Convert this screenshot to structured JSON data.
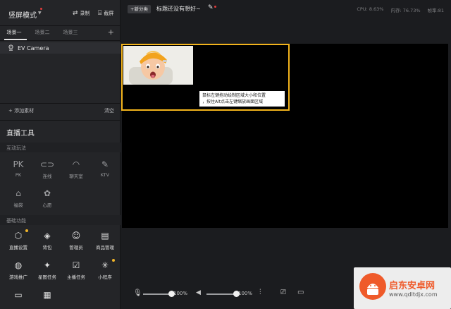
{
  "left_panel": {
    "mode_title": "竖屏模式",
    "record_label": "录制",
    "screenshot_label": "截屏",
    "scene_tabs": [
      "场景一",
      "场景二",
      "场景三"
    ],
    "sources": [
      {
        "label": "EV Camera"
      }
    ],
    "add_material": "+ 添加素材",
    "clear": "清空",
    "tools_title": "直播工具",
    "sections": {
      "interactive": "互动玩法",
      "basic": "基础功能"
    },
    "interactive_tools": [
      {
        "label": "PK",
        "icon": "pk-icon",
        "glyph": "PK"
      },
      {
        "label": "连线",
        "icon": "link-icon",
        "glyph": "⊂⊃"
      },
      {
        "label": "聊天室",
        "icon": "chat-room-icon",
        "glyph": "◠"
      },
      {
        "label": "KTV",
        "icon": "microphone-icon",
        "glyph": "✎"
      },
      {
        "label": "福袋",
        "icon": "lucky-bag-icon",
        "glyph": "⌂"
      },
      {
        "label": "心愿",
        "icon": "wish-icon",
        "glyph": "✿"
      }
    ],
    "basic_tools": [
      {
        "label": "直播设置",
        "icon": "settings-hex-icon",
        "glyph": "⬡"
      },
      {
        "label": "背包",
        "icon": "backpack-icon",
        "glyph": "◈"
      },
      {
        "label": "管理员",
        "icon": "admin-icon",
        "glyph": "☺"
      },
      {
        "label": "商品管理",
        "icon": "shop-icon",
        "glyph": "▤"
      },
      {
        "label": "游戏推广",
        "icon": "gamepad-icon",
        "glyph": "◍"
      },
      {
        "label": "星图任务",
        "icon": "star-map-icon",
        "glyph": "✦"
      },
      {
        "label": "主播任务",
        "icon": "task-check-icon",
        "glyph": "☑"
      },
      {
        "label": "小程序",
        "icon": "mini-program-icon",
        "glyph": "✳"
      },
      {
        "label": "",
        "icon": "screen-share-icon",
        "glyph": "▭"
      },
      {
        "label": "",
        "icon": "layout-icon",
        "glyph": "▦"
      }
    ]
  },
  "top_bar": {
    "new_button": "+新分类",
    "live_title": "标题还没有想好~",
    "stats": {
      "cpu": "CPU: 8.63%",
      "memory": "内存: 76.73%",
      "frames": "帧率:81"
    }
  },
  "preview": {
    "tip_lines": [
      "鼠标左键拖动绘制区域大小和位置",
      "，按住Alt点击左键缩放画面区域"
    ]
  },
  "bottom_bar": {
    "mic_volume": "100%",
    "speaker_volume": "100%",
    "mic_level": 1.0,
    "speaker_level": 1.0
  },
  "watermark": {
    "name": "启东安卓网",
    "url": "www.qdltdjx.com"
  },
  "colors": {
    "selection": "#f2b31c",
    "accent_dot": "#e23b3b",
    "badge": "#f0b429"
  }
}
